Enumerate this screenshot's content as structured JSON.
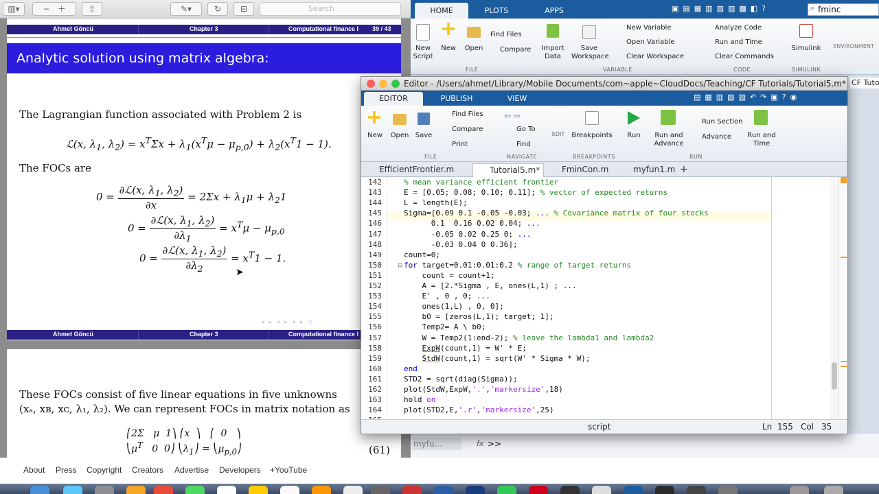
{
  "pdf": {
    "search_placeholder": "Search",
    "footer_top": {
      "author": "Ahmet Göncü",
      "chapter": "Chapter 3",
      "course": "Computational finance I",
      "page": "39 / 43"
    },
    "frame_title": "Analytic solution using matrix algebra:",
    "text1": "The Lagrangian function associated with Problem 2 is",
    "text2": "The FOCs are",
    "footer_bottom": {
      "author": "Ahmet Göncü",
      "chapter": "Chapter 3",
      "course": "Computational finance I"
    },
    "text3": "These FOCs consist of five linear equations in five unknowns",
    "text4": "(xₐ, xʙ, xᴄ, λ₁, λ₂). We can represent FOCs in matrix notation as",
    "eq_number": "(61)"
  },
  "youtube_footer": [
    "About",
    "Press",
    "Copyright",
    "Creators",
    "Advertise",
    "Developers",
    "+YouTube"
  ],
  "matlab": {
    "tabs": [
      "HOME",
      "PLOTS",
      "APPS"
    ],
    "search_value": "fminc",
    "buttons": {
      "new_script": "New\nScript",
      "new": "New",
      "open": "Open",
      "find_files": "Find Files",
      "compare": "Compare",
      "import_data": "Import\nData",
      "save_workspace": "Save\nWorkspace",
      "new_variable": "New Variable",
      "open_variable": "Open Variable",
      "clear_workspace": "Clear Workspace",
      "analyze_code": "Analyze Code",
      "run_and_time": "Run and Time",
      "clear_commands": "Clear Commands",
      "simulink": "Simulink",
      "environment": "ENVIRONMENT"
    },
    "sections": [
      "FILE",
      "VARIABLE",
      "CODE",
      "SIMULINK"
    ],
    "path_tab": "CF Tutorials",
    "command_line": "myfu...",
    "prompt": ">>"
  },
  "editor": {
    "title": "Editor - /Users/ahmet/Library/Mobile Documents/com~apple~CloudDocs/Teaching/CF Tutorials/Tutorial5.m*",
    "tabs": [
      "EDITOR",
      "PUBLISH",
      "VIEW"
    ],
    "buttons": {
      "new": "New",
      "open": "Open",
      "save": "Save",
      "find_files": "Find Files",
      "compare": "Compare",
      "print": "Print",
      "go_to": "Go To",
      "find": "Find",
      "edit": "EDIT",
      "breakpoints": "Breakpoints",
      "run": "Run",
      "run_and_advance": "Run and\nAdvance",
      "run_section": "Run Section",
      "advance": "Advance",
      "run_and_time": "Run and\nTime"
    },
    "sections": [
      "FILE",
      "NAVIGATE",
      "BREAKPOINTS",
      "RUN"
    ],
    "doc_tabs": [
      "EfficientFrontier.m",
      "Tutorial5.m*",
      "FminCon.m",
      "myfun1.m",
      "+"
    ],
    "lines": [
      {
        "n": "142",
        "html": "<span class=\"cmt\">% mean variance efficient frontier</span>"
      },
      {
        "n": "143",
        "html": "E = [0.05; 0.08; 0.10; 0.11]; <span class=\"cmt\">% vector of expected returns</span>"
      },
      {
        "n": "144",
        "html": "L = length(E);"
      },
      {
        "n": "145",
        "html": "Sigma=[0.09 0.1 -0.05 -0.03; <span class=\"kw\">...</span> <span class=\"cmt\">% Covariance matrix of four stocks</span>"
      },
      {
        "n": "146",
        "html": "      0.1  0.16 0.02 0.04; <span class=\"kw\">...</span>"
      },
      {
        "n": "147",
        "html": "      -0.05 0.02 0.25 0; <span class=\"kw\">...</span>"
      },
      {
        "n": "148",
        "html": "      -0.03 0.04 0 0.36];"
      },
      {
        "n": "149",
        "html": "count=0;"
      },
      {
        "n": "150",
        "html": "<span class=\"kw\">for</span> target=0.01:0.01:0.2 <span class=\"cmt\">% range of target returns</span>"
      },
      {
        "n": "151",
        "html": "    count = count+1;"
      },
      {
        "n": "152",
        "html": "    A = [2.*Sigma , E, ones(L,1) ; <span class=\"kw\">...</span>"
      },
      {
        "n": "153",
        "html": "    E' , 0 , 0; <span class=\"kw\">...</span>"
      },
      {
        "n": "154",
        "html": "    ones(1,L) , 0, 0];"
      },
      {
        "n": "155",
        "html": "    b0 = [zeros(L,1); target; 1];"
      },
      {
        "n": "156",
        "html": "    Temp2= A \\ b0;"
      },
      {
        "n": "157",
        "html": "    W = Temp2(1:end-2); <span class=\"cmt\">% leave the lambda1 and lambda2</span>"
      },
      {
        "n": "158",
        "html": "    <u style=\"text-decoration-color:#e08000\">ExpW</u>(count,1) = W' * E;"
      },
      {
        "n": "159",
        "html": "    <u style=\"text-decoration-color:#e08000\">StdW</u>(count,1) = sqrt(W' * Sigma * W);"
      },
      {
        "n": "160",
        "html": "<span class=\"kw\">end</span>"
      },
      {
        "n": "161",
        "html": "STD2 = sqrt(diag(Sigma));"
      },
      {
        "n": "162",
        "html": "plot(StdW,ExpW,<span class=\"str\">'.'</span>,<span class=\"str\">'markersize'</span>,18)"
      },
      {
        "n": "163",
        "html": "hold <span class=\"str\">on</span>"
      },
      {
        "n": "164",
        "html": "plot(STD2,E,<span class=\"str\">'.r'</span>,<span class=\"str\">'markersize'</span>,25)"
      },
      {
        "n": "165",
        "html": ""
      }
    ],
    "status": {
      "mode": "script",
      "ln_label": "Ln",
      "ln": "155",
      "col_label": "Col",
      "col": "35"
    }
  },
  "colors": {
    "matlab_blue": "#1b5c9e",
    "beamer_bar": "#2a2086",
    "beamer_title": "#2a1ddd",
    "comment": "#228b22",
    "keyword": "#0000ff",
    "string": "#a020f0"
  }
}
